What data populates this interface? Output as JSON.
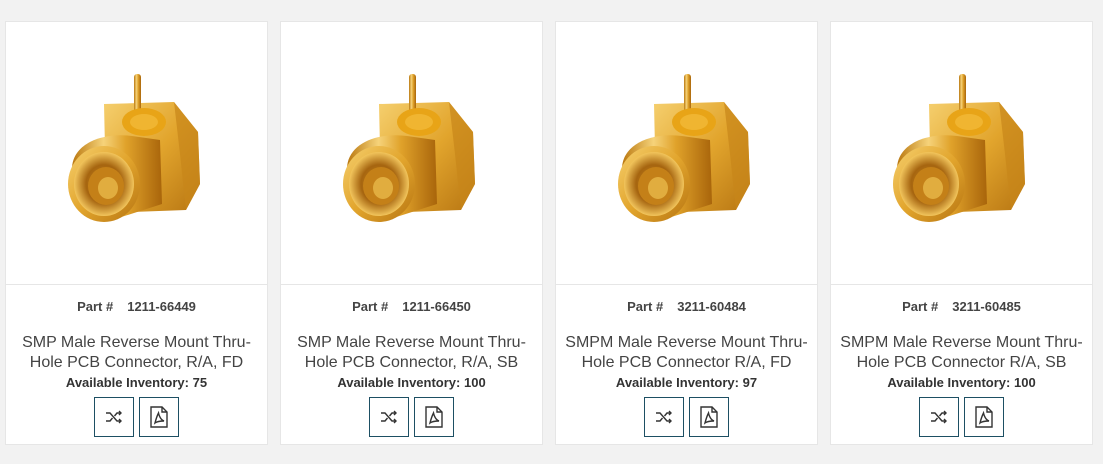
{
  "products": [
    {
      "part_label": "Part #",
      "part_number": "1211-66449",
      "title": "SMP Male Reverse Mount Thru-Hole PCB Connector, R/A, FD",
      "inventory": "Available Inventory: 75",
      "image_icon": "connector-image",
      "compare_icon": "shuffle-icon",
      "pdf_icon": "pdf-icon"
    },
    {
      "part_label": "Part #",
      "part_number": "1211-66450",
      "title": "SMP Male Reverse Mount Thru-Hole PCB Connector, R/A, SB",
      "inventory": "Available Inventory: 100",
      "image_icon": "connector-image",
      "compare_icon": "shuffle-icon",
      "pdf_icon": "pdf-icon"
    },
    {
      "part_label": "Part #",
      "part_number": "3211-60484",
      "title": "SMPM Male Reverse Mount Thru-Hole PCB Connector R/A, FD",
      "inventory": "Available Inventory: 97",
      "image_icon": "connector-image",
      "compare_icon": "shuffle-icon",
      "pdf_icon": "pdf-icon"
    },
    {
      "part_label": "Part #",
      "part_number": "3211-60485",
      "title": "SMPM Male Reverse Mount Thru-Hole PCB Connector R/A, SB",
      "inventory": "Available Inventory: 100",
      "image_icon": "connector-image",
      "compare_icon": "shuffle-icon",
      "pdf_icon": "pdf-icon"
    }
  ],
  "colors": {
    "button_border": "#1d4f63",
    "gold": "#d9a520",
    "text": "#444444"
  }
}
